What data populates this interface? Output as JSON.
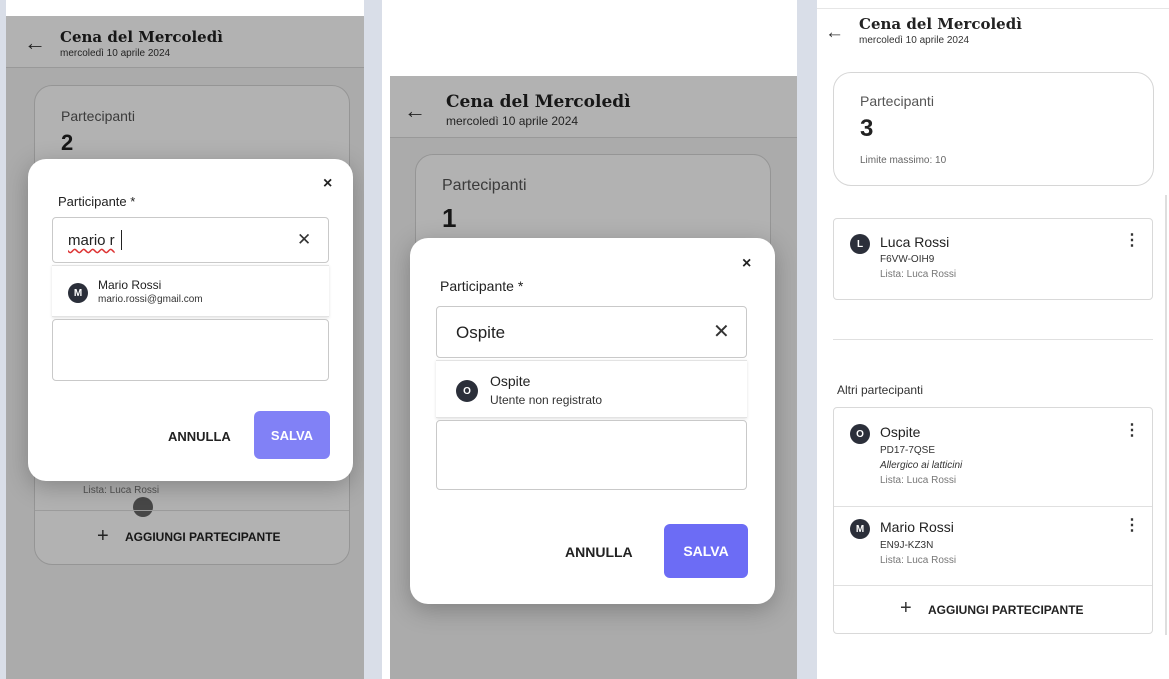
{
  "event": {
    "title": "Cena del Mercoledì",
    "date": "mercoledì 10 aprile 2024"
  },
  "participants_card": {
    "label": "Partecipanti",
    "count_left": "2",
    "count_middle": "1",
    "count_right": "3",
    "limit": "Limite massimo: 10"
  },
  "dialog": {
    "label": "Participante *",
    "close_icon": "×",
    "clear_icon": "✕",
    "cancel": "ANNULLA",
    "save": "SALVA"
  },
  "left": {
    "search_value": "mario r",
    "option": {
      "initial": "M",
      "name": "Mario Rossi",
      "email": "mario.rossi@gmail.com"
    },
    "bg_list": "Lista: Luca Rossi",
    "add_label": "AGGIUNGI PARTECIPANTE"
  },
  "middle": {
    "search_value": "Ospite",
    "option": {
      "initial": "O",
      "name": "Ospite",
      "sub": "Utente non registrato"
    }
  },
  "right": {
    "owner": {
      "initial": "L",
      "name": "Luca Rossi",
      "code": "F6VW-OIH9",
      "list": "Lista: Luca Rossi"
    },
    "others_heading": "Altri partecipanti",
    "others": [
      {
        "initial": "O",
        "name": "Ospite",
        "code": "PD17-7QSE",
        "note": "Allergico ai latticini",
        "list": "Lista: Luca Rossi"
      },
      {
        "initial": "M",
        "name": "Mario Rossi",
        "code": "EN9J-KZ3N",
        "list": "Lista: Luca Rossi"
      }
    ],
    "add_label": "AGGIUNGI PARTECIPANTE"
  },
  "icons": {
    "back": "back-arrow-icon",
    "plus": "plus-icon",
    "kebab": "more-vertical-icon",
    "close": "close-icon",
    "clear": "clear-icon"
  },
  "colors": {
    "primary": "#6c6cf5",
    "avatar": "#2b2f3a",
    "overlay": "rgba(0,0,0,0.30)"
  }
}
